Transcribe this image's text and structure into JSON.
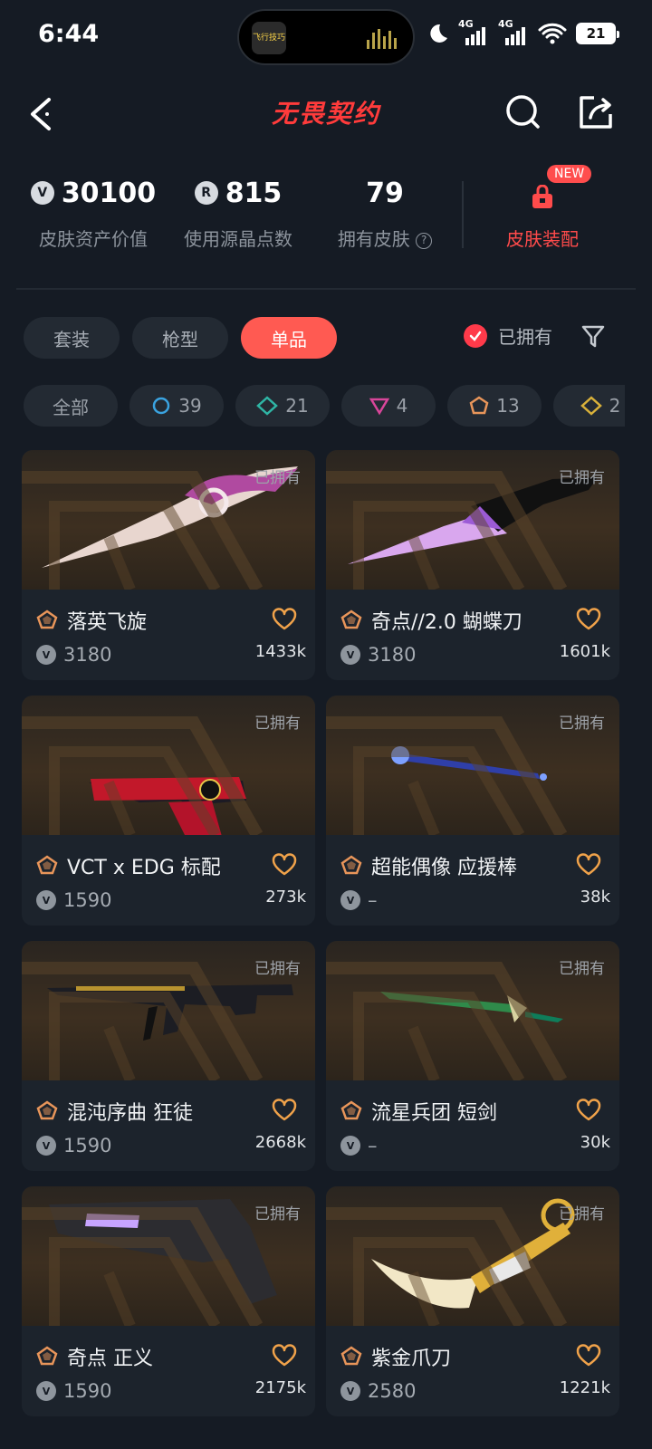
{
  "status_bar": {
    "time": "6:44",
    "island_app_text": "飞行技巧",
    "battery": "21",
    "network1": "4G",
    "network2": "4G",
    "wifi_sub": "6"
  },
  "header": {
    "title": "无畏契约"
  },
  "stats": {
    "asset_value": "30100",
    "asset_value_label": "皮肤资产价值",
    "radianite": "815",
    "radianite_label": "使用源晶点数",
    "owned_skins": "79",
    "owned_skins_label": "拥有皮肤",
    "equip_label": "皮肤装配",
    "equip_badge": "NEW"
  },
  "tabs": [
    {
      "label": "套装",
      "active": false
    },
    {
      "label": "枪型",
      "active": false
    },
    {
      "label": "单品",
      "active": true
    }
  ],
  "owned_filter": {
    "label": "已拥有",
    "checked": true
  },
  "tier_chips": [
    {
      "label": "全部",
      "count": ""
    },
    {
      "label": "",
      "count": "39",
      "color": "#3aa3e0",
      "shape": "circle"
    },
    {
      "label": "",
      "count": "21",
      "color": "#2fb5a5",
      "shape": "diamond"
    },
    {
      "label": "",
      "count": "4",
      "color": "#d9469a",
      "shape": "triangle"
    },
    {
      "label": "",
      "count": "13",
      "color": "#e8955a",
      "shape": "pentagon"
    },
    {
      "label": "",
      "count": "2",
      "color": "#d9b13a",
      "shape": "diamond"
    }
  ],
  "skins": [
    {
      "name": "落英飞旋",
      "price": "3180",
      "likes": "1433k",
      "owned_label": "已拥有",
      "weapon": "knife-pink"
    },
    {
      "name": "奇点//2.0 蝴蝶刀",
      "price": "3180",
      "likes": "1601k",
      "owned_label": "已拥有",
      "weapon": "knife-black"
    },
    {
      "name": "VCT x EDG 标配",
      "price": "1590",
      "likes": "273k",
      "owned_label": "已拥有",
      "weapon": "pistol"
    },
    {
      "name": "超能偶像 应援棒",
      "price": "–",
      "likes": "38k",
      "owned_label": "已拥有",
      "weapon": "baton"
    },
    {
      "name": "混沌序曲 狂徒",
      "price": "1590",
      "likes": "2668k",
      "owned_label": "已拥有",
      "weapon": "rifle"
    },
    {
      "name": "流星兵团 短剑",
      "price": "–",
      "likes": "30k",
      "owned_label": "已拥有",
      "weapon": "sword-green"
    },
    {
      "name": "奇点 正义",
      "price": "1590",
      "likes": "2175k",
      "owned_label": "已拥有",
      "weapon": "revolver"
    },
    {
      "name": "紫金爪刀",
      "price": "2580",
      "likes": "1221k",
      "owned_label": "已拥有",
      "weapon": "karambit"
    }
  ]
}
